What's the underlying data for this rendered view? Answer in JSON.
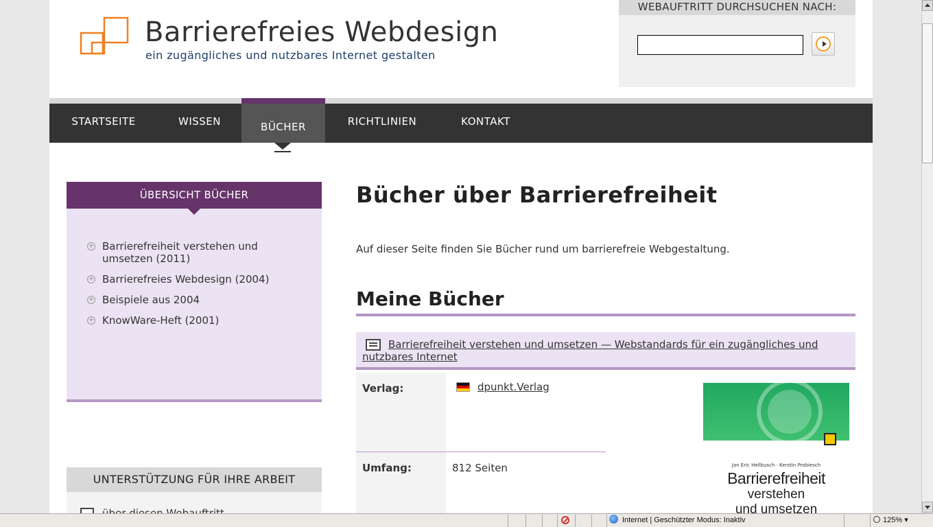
{
  "header": {
    "site_title": "Barrierefreies Webdesign",
    "tagline": "ein zugängliches und nutzbares Internet gestalten",
    "logo_icon": "overlapping-squares-logo"
  },
  "search": {
    "label": "WEBAUFTRITT DURCHSUCHEN NACH:",
    "value": "",
    "button_icon": "arrow-right-circle-icon"
  },
  "nav": {
    "items": [
      {
        "label": "STARTSEITE"
      },
      {
        "label": "WISSEN"
      },
      {
        "label": "BÜCHER",
        "active": true
      },
      {
        "label": "RICHTLINIEN"
      },
      {
        "label": "KONTAKT"
      }
    ]
  },
  "sidebar": {
    "heading": "ÜBERSICHT BÜCHER",
    "items": [
      {
        "label": "Barrierefreiheit verstehen und umsetzen (2011)"
      },
      {
        "label": "Barrierefreies Webdesign (2004)"
      },
      {
        "label": "Beispiele aus 2004"
      },
      {
        "label": "KnowWare-Heft (2001)"
      }
    ],
    "support": {
      "heading": "UNTERSTÜTZUNG FÜR IHRE ARBEIT",
      "item": "über diesen Webauftritt"
    }
  },
  "main": {
    "title": "Bücher über Barrierefreiheit",
    "intro": "Auf dieser Seite finden Sie Bücher rund um barrierefreie Webgestaltung.",
    "section_title": "Meine Bücher",
    "book": {
      "title_link": "Barrierefreiheit verstehen und umsetzen — Webstandards für ein zugängliches und nutzbares Internet",
      "publisher_label": "Verlag:",
      "publisher": "dpunkt.Verlag",
      "pages_label": "Umfang:",
      "pages": "812 Seiten",
      "cover": {
        "authors": "Jan Eric Hellbusch · Kerstin Probiesch",
        "title_line1": "Barrierefreiheit",
        "title_line2": "verstehen",
        "title_line3": "und umsetzen"
      }
    }
  },
  "statusbar": {
    "zone": "Internet | Geschützter Modus: Inaktiv",
    "zoom": "125%"
  },
  "colors": {
    "accent_purple": "#66336a",
    "light_purple": "#ebe3f3",
    "rule_purple": "#b497c4",
    "nav_bg": "#333333",
    "logo_orange": "#f08020"
  }
}
